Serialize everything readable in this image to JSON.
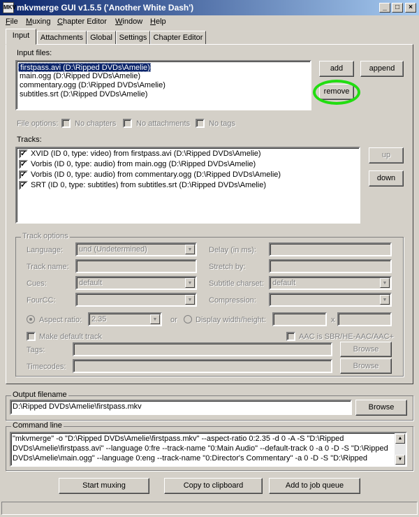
{
  "window": {
    "title": "mkvmerge GUI v1.5.5 ('Another White Dash')",
    "app_icon": "MKV"
  },
  "menu": [
    {
      "u": "F",
      "rest": "ile"
    },
    {
      "u": "M",
      "rest": "uxing"
    },
    {
      "u": "C",
      "rest": "hapter Editor"
    },
    {
      "u": "W",
      "rest": "indow"
    },
    {
      "u": "H",
      "rest": "elp"
    }
  ],
  "tabs": [
    "Input",
    "Attachments",
    "Global",
    "Settings",
    "Chapter Editor"
  ],
  "input": {
    "files_label": "Input files:",
    "files": [
      "firstpass.avi (D:\\Ripped DVDs\\Amelie)",
      "main.ogg (D:\\Ripped DVDs\\Amelie)",
      "commentary.ogg (D:\\Ripped DVDs\\Amelie)",
      "subtitles.srt (D:\\Ripped DVDs\\Amelie)"
    ],
    "add": "add",
    "append": "append",
    "remove": "remove",
    "file_options_label": "File options:",
    "no_chapters": "No chapters",
    "no_attachments": "No attachments",
    "no_tags": "No tags",
    "tracks_label": "Tracks:",
    "tracks": [
      "XVID (ID 0, type: video) from firstpass.avi (D:\\Ripped DVDs\\Amelie)",
      "Vorbis (ID 0, type: audio) from main.ogg (D:\\Ripped DVDs\\Amelie)",
      "Vorbis (ID 0, type: audio) from commentary.ogg (D:\\Ripped DVDs\\Amelie)",
      "SRT (ID 0, type: subtitles) from subtitles.srt (D:\\Ripped DVDs\\Amelie)"
    ],
    "up": "up",
    "down": "down"
  },
  "track_options": {
    "title": "Track options",
    "language_label": "Language:",
    "language_value": "und (Undetermined)",
    "delay_label": "Delay (in ms):",
    "track_name_label": "Track name:",
    "stretch_label": "Stretch by:",
    "cues_label": "Cues:",
    "cues_value": "default",
    "subtitle_charset_label": "Subtitle charset:",
    "subtitle_charset_value": "default",
    "fourcc_label": "FourCC:",
    "compression_label": "Compression:",
    "aspect_ratio_label": "Aspect ratio:",
    "aspect_ratio_value": "2.35",
    "or_label": "or",
    "display_wh_label": "Display width/height:",
    "x_label": "x",
    "make_default_label": "Make default track",
    "aac_label": "AAC is SBR/HE-AAC/AAC+",
    "tags_label": "Tags:",
    "timecodes_label": "Timecodes:",
    "browse": "Browse"
  },
  "output": {
    "title": "Output filename",
    "value": "D:\\Ripped DVDs\\Amelie\\firstpass.mkv",
    "browse": "Browse"
  },
  "command": {
    "title": "Command line",
    "lines": [
      "\"mkvmerge\" -o \"D:\\Ripped DVDs\\Amelie\\firstpass.mkv\"  --aspect-ratio 0:2.35 -d 0 -A -S \"D:\\Ripped",
      "DVDs\\Amelie\\firstpass.avi\" --language 0:fre --track-name \"0:Main Audio\" --default-track 0 -a 0 -D -S \"D:\\Ripped",
      "DVDs\\Amelie\\main.ogg\" --language 0:eng --track-name \"0:Director's Commentary\" -a 0 -D -S \"D:\\Ripped"
    ]
  },
  "actions": {
    "start": "Start muxing",
    "copy": "Copy to clipboard",
    "queue": "Add to job queue"
  },
  "colors": {
    "highlight": "#22dd11",
    "selection": "#0a246a"
  }
}
